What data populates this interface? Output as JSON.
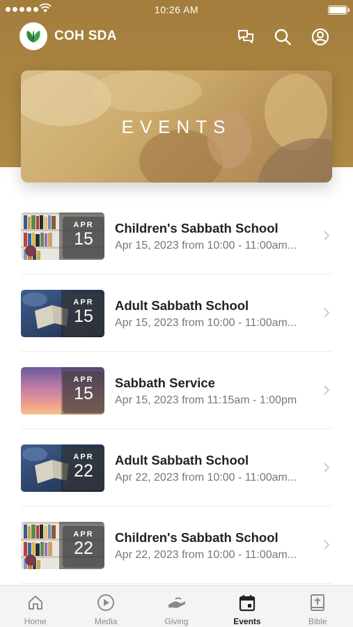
{
  "status_bar": {
    "time": "10:26 AM"
  },
  "app_bar": {
    "title": "COH SDA"
  },
  "banner": {
    "title": "EVENTS"
  },
  "events": [
    {
      "title": "Children's Sabbath School",
      "subtitle": "Apr 15, 2023 from 10:00 - 11:00am...",
      "month": "APR",
      "day": "15",
      "thumb": "bookshelf"
    },
    {
      "title": "Adult Sabbath School",
      "subtitle": "Apr 15, 2023 from 10:00 - 11:00am...",
      "month": "APR",
      "day": "15",
      "thumb": "bible"
    },
    {
      "title": "Sabbath Service",
      "subtitle": "Apr 15, 2023 from 11:15am - 1:00pm",
      "month": "APR",
      "day": "15",
      "thumb": "sunset"
    },
    {
      "title": "Adult Sabbath School",
      "subtitle": "Apr 22, 2023 from 10:00 - 11:00am...",
      "month": "APR",
      "day": "22",
      "thumb": "bible"
    },
    {
      "title": "Children's Sabbath School",
      "subtitle": "Apr 22, 2023 from 10:00 - 11:00am...",
      "month": "APR",
      "day": "22",
      "thumb": "bookshelf"
    }
  ],
  "tabs": [
    {
      "label": "Home",
      "icon": "home-icon"
    },
    {
      "label": "Media",
      "icon": "play-icon"
    },
    {
      "label": "Giving",
      "icon": "giving-icon"
    },
    {
      "label": "Events",
      "icon": "calendar-icon",
      "active": true
    },
    {
      "label": "Bible",
      "icon": "bible-icon"
    }
  ],
  "colors": {
    "header": "#a37d3c",
    "accent_green": "#2e8b3d",
    "tab_active": "#222222",
    "tab_inactive": "#8a8a8a"
  }
}
